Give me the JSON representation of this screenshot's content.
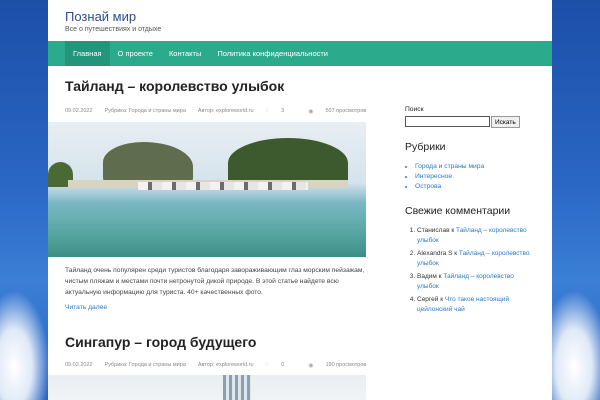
{
  "site": {
    "title": "Познай мир",
    "description": "Все о путешествиях и отдыхе"
  },
  "nav": {
    "items": [
      {
        "label": "Главная",
        "active": true
      },
      {
        "label": "О проекте"
      },
      {
        "label": "Контакты"
      },
      {
        "label": "Политика конфиденциальности"
      }
    ]
  },
  "posts": [
    {
      "title": "Тайланд – королевство улыбок",
      "date": "09.02.2022",
      "category": "Рубрика: Города и страны мира",
      "author": "Автор: exploreworld.ru",
      "comments": "3",
      "views": "507 просмотров",
      "excerpt": "Тайланд очень популярен среди туристов благодаря завораживающим глаз морским пейзажам, чистым пляжам и местами почти нетронутой дикой природе. В этой статье найдете всю актуальную информацию для туриста. 40+ качественных фото.",
      "read_more": "Читать далее"
    },
    {
      "title": "Сингапур – город будущего",
      "date": "09.02.2022",
      "category": "Рубрика: Города и страны мира",
      "author": "Автор: exploreworld.ru",
      "comments": "0",
      "views": "190 просмотров"
    }
  ],
  "sidebar": {
    "search": {
      "label": "Поиск",
      "value": "",
      "button": "Искать"
    },
    "categories": {
      "title": "Рубрики",
      "items": [
        "Города и страны мира",
        "Интересное",
        "Острова"
      ]
    },
    "recent_comments": {
      "title": "Свежие комментарии",
      "items": [
        {
          "author": "Станислав",
          "sep": " к ",
          "post": "Тайланд – королевство улыбок"
        },
        {
          "author": "Alexandra S",
          "sep": " к ",
          "post": "Тайланд – королевство улыбок"
        },
        {
          "author": "Вадим",
          "sep": " к ",
          "post": "Тайланд – королевство улыбок"
        },
        {
          "author": "Сергей",
          "sep": " к ",
          "post": "Что такое настоящий цейлонский чай"
        }
      ]
    }
  },
  "icons": {
    "comments": "speech-bubble-icon",
    "views": "eye-icon"
  },
  "colors": {
    "nav_bg": "#2bab8c",
    "nav_active": "#23957a",
    "link": "#2b7bc6",
    "title": "#2b4e8c"
  }
}
